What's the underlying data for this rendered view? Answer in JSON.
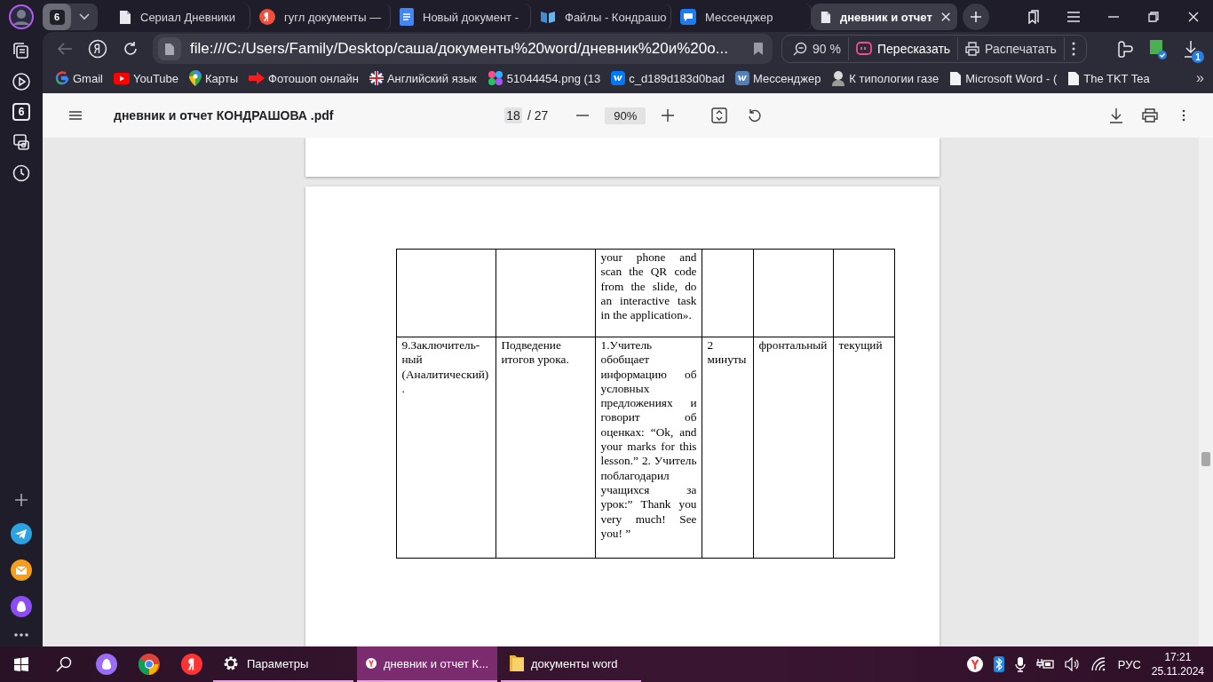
{
  "sidebar": {
    "tab_count": "6"
  },
  "tab_group": {
    "count": "6"
  },
  "tabs": [
    {
      "title": "Сериал Дневники",
      "kind": "page",
      "selected": false
    },
    {
      "title": "гугл документы —",
      "kind": "yandex",
      "selected": false
    },
    {
      "title": "Новый документ -",
      "kind": "docs",
      "selected": false
    },
    {
      "title": "Файлы - Кондрашо",
      "kind": "book",
      "selected": false
    },
    {
      "title": "Мессенджер",
      "kind": "messenger",
      "selected": false
    },
    {
      "title": "дневник и отчет",
      "kind": "page",
      "selected": true
    }
  ],
  "toolbar": {
    "back": {
      "disabled": true
    },
    "url": "file:///C:/Users/Family/Desktop/саша/документы%20word/дневник%20и%20о...",
    "zoom": "90 %",
    "retell": "Пересказать",
    "print": "Распечатать",
    "downloads_badge": "1"
  },
  "bookmarks": [
    {
      "label": "Gmail",
      "kind": "gmail"
    },
    {
      "label": "YouTube",
      "kind": "youtube"
    },
    {
      "label": "Карты",
      "kind": "maps"
    },
    {
      "label": "Фотошоп онлайн",
      "kind": "arrow"
    },
    {
      "label": "Английский язык",
      "kind": "flag"
    },
    {
      "label": "51044454.png (13",
      "kind": "dots"
    },
    {
      "label": "c_d189d183d0bad",
      "kind": "vk"
    },
    {
      "label": "Мессенджер",
      "kind": "vk_light"
    },
    {
      "label": "К типологии газе",
      "kind": "figure"
    },
    {
      "label": "Microsoft Word - (",
      "kind": "page"
    },
    {
      "label": "The TKT Tea",
      "kind": "page"
    }
  ],
  "bookmarks_more": "»",
  "pdf": {
    "title": "дневник и отчет КОНДРАШОВА .pdf",
    "page": "18",
    "page_total": "/ 27",
    "zoom": "90%",
    "table": {
      "rows": [
        [
          null,
          null,
          "your phone and scan the QR code from the slide, do an interactive task in the application».",
          null,
          null,
          null
        ],
        [
          "9.Заключитель-ный (Аналитический).",
          "Подведение итогов урока.",
          "1.Учитель обобщает информацию об условных предложениях и говорит об оценках: “Ok, and your marks for this lesson.” 2. Учитель поблагодарил учащихся за урок:” Thank you very much! See you! ”",
          "2 минуты",
          "фронтальный",
          "текущий"
        ]
      ]
    }
  },
  "taskbar": {
    "windows": [
      {
        "label": "Параметры",
        "kind": "gear",
        "selected": false
      },
      {
        "label": "дневник и отчет К...",
        "kind": "yandex_browser",
        "selected": true
      },
      {
        "label": "документы word",
        "kind": "folder",
        "selected": false
      }
    ],
    "tray": {
      "language": "РУС",
      "time": "17:21",
      "date": "25.11.2024"
    }
  }
}
